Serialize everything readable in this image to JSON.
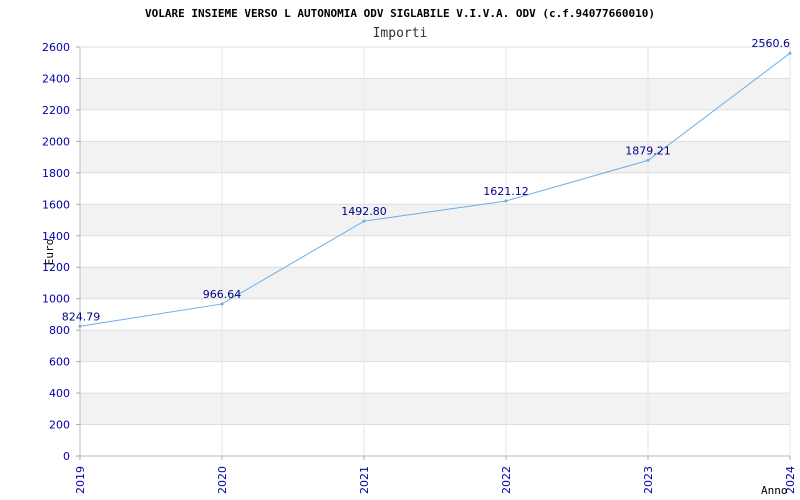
{
  "chart_data": {
    "type": "line",
    "title": "VOLARE INSIEME VERSO L AUTONOMIA ODV SIGLABILE V.I.V.A. ODV (c.f.94077660010)",
    "subtitle": "Importi",
    "xlabel": "Anno",
    "ylabel": "Euro",
    "x": [
      "2019",
      "2020",
      "2021",
      "2022",
      "2023",
      "2024"
    ],
    "values": [
      824.79,
      966.64,
      1492.8,
      1621.12,
      1879.21,
      2560.6
    ],
    "data_labels": [
      "824.79",
      "966.64",
      "1492.80",
      "1621.12",
      "1879.21",
      "2560.6"
    ],
    "ylim": [
      0,
      2600
    ],
    "yticks": [
      0,
      200,
      400,
      600,
      800,
      1000,
      1200,
      1400,
      1600,
      1800,
      2000,
      2200,
      2400,
      2600
    ],
    "grid": true,
    "colors": {
      "line": "#6aaee8",
      "band": "#f2f2f2",
      "gridline": "#dddddd",
      "tick_text": "#0000aa",
      "data_label_text": "#000088"
    }
  }
}
